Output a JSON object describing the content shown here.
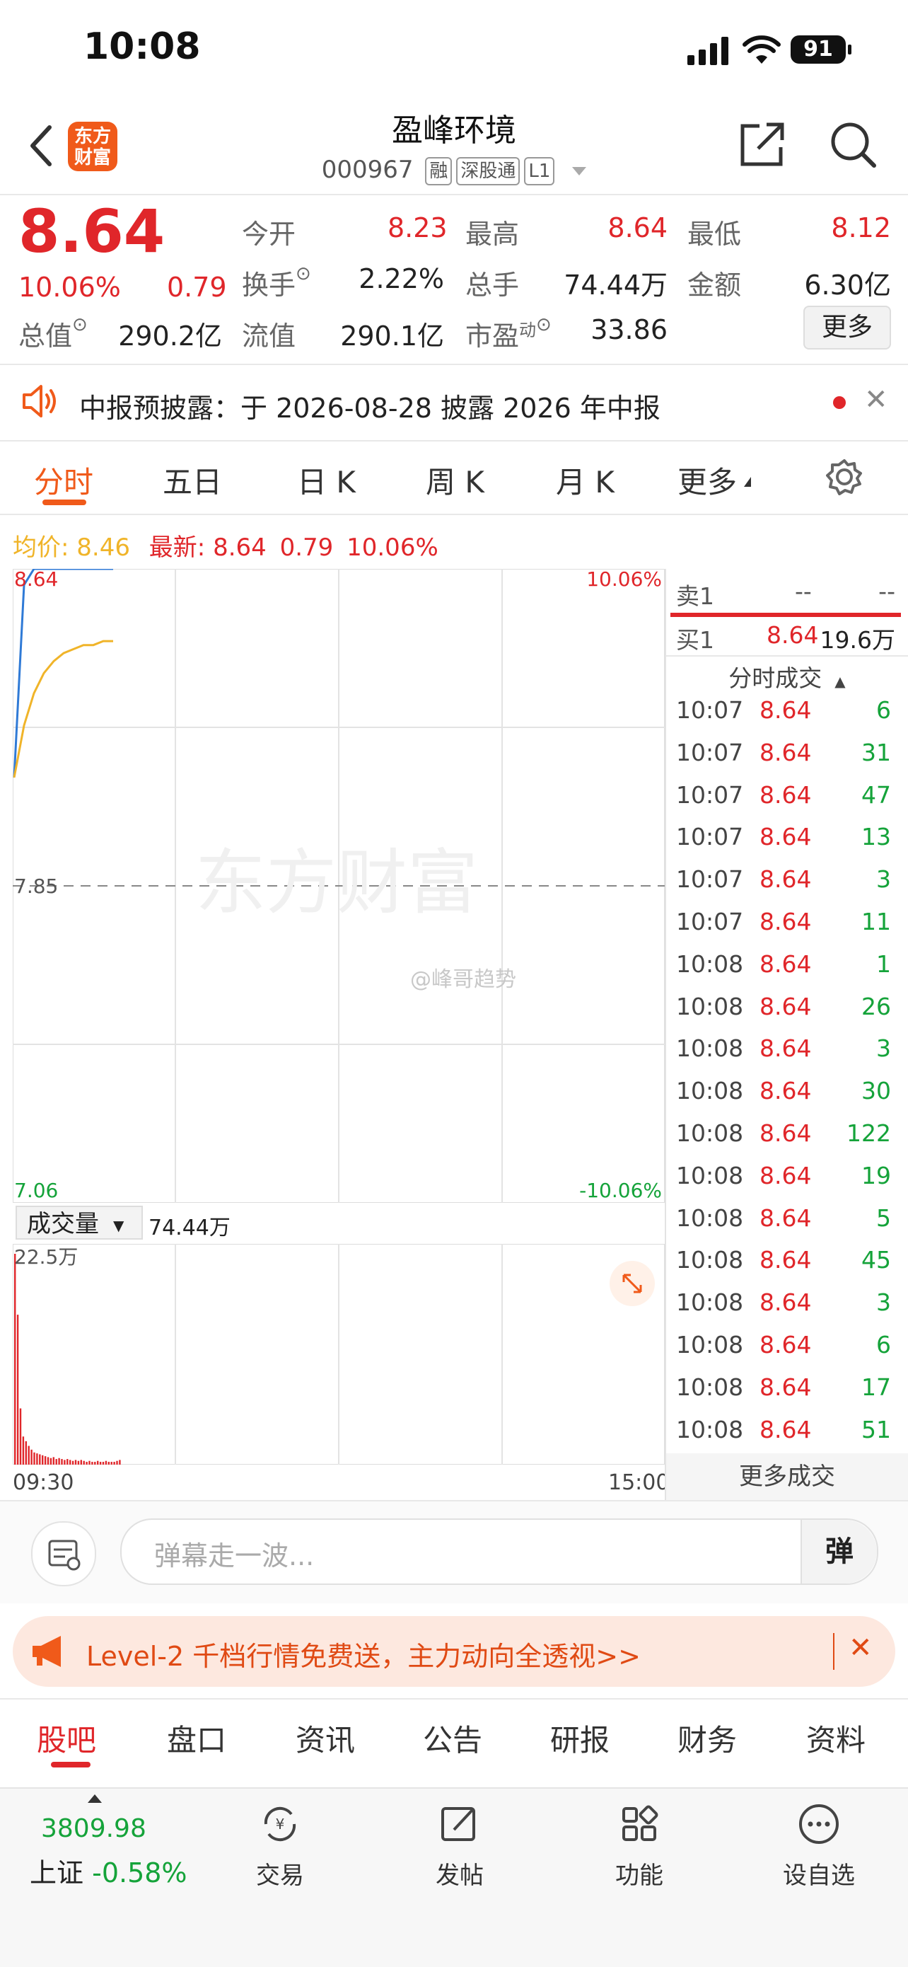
{
  "status": {
    "time": "10:08",
    "battery": "91"
  },
  "header": {
    "title": "盈峰环境",
    "code": "000967",
    "tags": [
      "融",
      "深股通",
      "L1"
    ],
    "logo_text": "东方财富"
  },
  "quote": {
    "price": "8.64",
    "pct": "10.06%",
    "chg": "0.79",
    "row1": [
      {
        "label": "今开",
        "value": "8.23"
      },
      {
        "label": "最高",
        "value": "8.64"
      },
      {
        "label": "最低",
        "value": "8.12"
      }
    ],
    "row2": [
      {
        "label": "换手",
        "value": "2.22%"
      },
      {
        "label": "总手",
        "value": "74.44万"
      },
      {
        "label": "金额",
        "value": "6.30亿"
      }
    ],
    "row3": [
      {
        "label": "总值",
        "value": "290.2亿"
      },
      {
        "label": "流值",
        "value": "290.1亿"
      },
      {
        "label": "市盈",
        "sup": "动",
        "value": "33.86"
      }
    ],
    "more_button": "更多"
  },
  "notice": {
    "text": "中报预披露：于 2026-08-28 披露 2026 年中报"
  },
  "chart_tabs": [
    "分时",
    "五日",
    "日 K",
    "周 K",
    "月 K",
    "更多"
  ],
  "legend": {
    "avg_label": "均价:",
    "avg_value": "8.46",
    "last_label": "最新:",
    "last_value": "8.64",
    "chg": "0.79",
    "pct": "10.06%"
  },
  "chart_labels": {
    "top_left": "8.64",
    "top_right": "10.06%",
    "mid": "7.85",
    "bot_left": "7.06",
    "bot_right": "-10.06%",
    "watermark": "东方财富",
    "weibo": "@峰哥趋势"
  },
  "chart_data": {
    "type": "line",
    "series": [
      {
        "values": [
          8.12,
          8.6,
          8.64,
          8.64,
          8.64,
          8.64,
          8.64,
          8.64,
          8.64,
          8.64,
          8.64
        ]
      },
      {
        "values": [
          8.12,
          8.25,
          8.33,
          8.38,
          8.41,
          8.43,
          8.44,
          8.45,
          8.45,
          8.46,
          8.46
        ]
      }
    ],
    "x_start": "09:30",
    "x_end": "15:00",
    "ylim": [
      7.06,
      8.64
    ],
    "volume_values": [
      22.5,
      16,
      6,
      3,
      2.5,
      2,
      1.6,
      1.3,
      1.2,
      1.1,
      1,
      0.9,
      0.8,
      0.7,
      0.8,
      0.6,
      0.7,
      0.6,
      0.5,
      0.6,
      0.5,
      0.4,
      0.5,
      0.4,
      0.5,
      0.4,
      0.3,
      0.4,
      0.3,
      0.3,
      0.4,
      0.3,
      0.3,
      0.4,
      0.3,
      0.3,
      0.3,
      0.4,
      0.5
    ],
    "volume_max": 22.5
  },
  "volume": {
    "selector": "成交量",
    "total": "74.44万",
    "max_label": "22.5万",
    "time_start": "09:30",
    "time_end": "15:00"
  },
  "orderbook": {
    "sell1_label": "卖1",
    "sell1_price": "--",
    "sell1_vol": "--",
    "buy1_label": "买1",
    "buy1_price": "8.64",
    "buy1_vol": "19.6万",
    "ticks_header": "分时成交",
    "more": "更多成交"
  },
  "ticks": [
    {
      "t": "10:07",
      "p": "8.64",
      "v": "6"
    },
    {
      "t": "10:07",
      "p": "8.64",
      "v": "31"
    },
    {
      "t": "10:07",
      "p": "8.64",
      "v": "47"
    },
    {
      "t": "10:07",
      "p": "8.64",
      "v": "13"
    },
    {
      "t": "10:07",
      "p": "8.64",
      "v": "3"
    },
    {
      "t": "10:07",
      "p": "8.64",
      "v": "11"
    },
    {
      "t": "10:08",
      "p": "8.64",
      "v": "1"
    },
    {
      "t": "10:08",
      "p": "8.64",
      "v": "26"
    },
    {
      "t": "10:08",
      "p": "8.64",
      "v": "3"
    },
    {
      "t": "10:08",
      "p": "8.64",
      "v": "30"
    },
    {
      "t": "10:08",
      "p": "8.64",
      "v": "122"
    },
    {
      "t": "10:08",
      "p": "8.64",
      "v": "19"
    },
    {
      "t": "10:08",
      "p": "8.64",
      "v": "5"
    },
    {
      "t": "10:08",
      "p": "8.64",
      "v": "45"
    },
    {
      "t": "10:08",
      "p": "8.64",
      "v": "3"
    },
    {
      "t": "10:08",
      "p": "8.64",
      "v": "6"
    },
    {
      "t": "10:08",
      "p": "8.64",
      "v": "17"
    },
    {
      "t": "10:08",
      "p": "8.64",
      "v": "51"
    }
  ],
  "danmu": {
    "placeholder": "弹幕走一波...",
    "button": "弹"
  },
  "promo": {
    "text": "Level-2 千档行情免费送，主力动向全透视>>"
  },
  "bottom_tabs": [
    "股吧",
    "盘口",
    "资讯",
    "公告",
    "研报",
    "财务",
    "资料"
  ],
  "index": {
    "value": "3809.98",
    "name": "上证",
    "pct": "-0.58%"
  },
  "nav": [
    {
      "label": "交易",
      "icon": "trade-icon"
    },
    {
      "label": "发帖",
      "icon": "post-icon"
    },
    {
      "label": "功能",
      "icon": "function-icon"
    },
    {
      "label": "设自选",
      "icon": "more-icon"
    }
  ],
  "colors": {
    "up": "#e0262a",
    "down": "#15a33a",
    "accent": "#f05a1a",
    "avg": "#f0b429",
    "price_line": "#2f7ad6"
  }
}
